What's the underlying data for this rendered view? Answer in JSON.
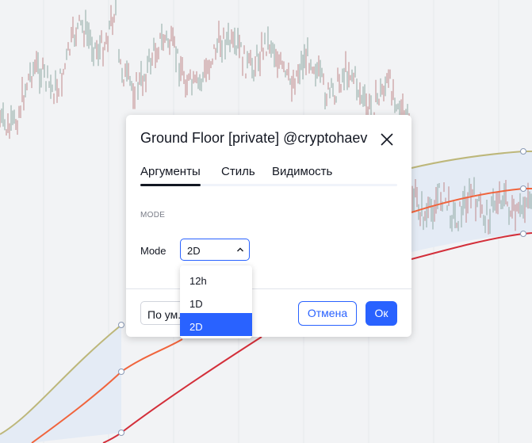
{
  "dialog": {
    "title": "Ground Floor [private] @cryptohaev",
    "tabs": [
      {
        "label": "Аргументы",
        "active": true
      },
      {
        "label": "Стиль",
        "active": false
      },
      {
        "label": "Видимость",
        "active": false
      }
    ],
    "section_heading": "MODE",
    "mode_field": {
      "label": "Mode",
      "value": "2D"
    },
    "defaults_button": "По ум...",
    "cancel_button": "Отмена",
    "ok_button": "Ок"
  },
  "dropdown": {
    "options": [
      "12h",
      "1D",
      "2D"
    ],
    "selected": "2D"
  },
  "colors": {
    "accent": "#2962ff",
    "band_fill": "#e4ebf5",
    "line_top": "#bdb77a",
    "line_mid": "#f0643c",
    "line_bottom": "#d32f3a",
    "candle_up": "#8fa8a2",
    "candle_down": "#c08a8a"
  },
  "icons": {
    "close": "close-icon",
    "chevron": "chevron-up-icon"
  }
}
